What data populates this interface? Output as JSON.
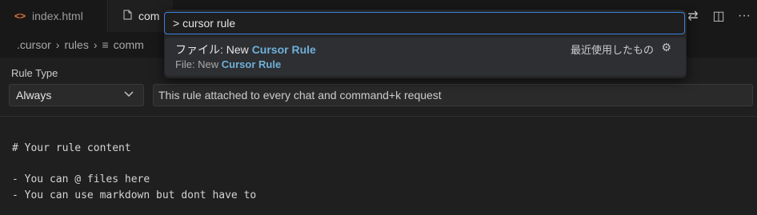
{
  "tabs": [
    {
      "label": "index.html",
      "icon": "html-code-icon"
    },
    {
      "label": "com",
      "icon": "file-icon"
    }
  ],
  "toolbar_icons": [
    "source-control-icon",
    "split-editor-icon",
    "more-icon"
  ],
  "breadcrumb": {
    "part1": ".cursor",
    "part2": "rules",
    "part3": "comm"
  },
  "rule_type": {
    "label": "Rule Type",
    "value": "Always"
  },
  "description": "This rule attached to every chat and command+k request",
  "code_lines": [
    "# Your rule content",
    "",
    "- You can @ files here",
    "- You can use markdown but dont have to"
  ],
  "palette": {
    "input_value": "> cursor rule",
    "item": {
      "line1_prefix": "ファイル: New ",
      "line1_match": "Cursor Rule",
      "line2_prefix": "File: New ",
      "line2_match": "Cursor Rule",
      "recent_label": "最近使用したもの"
    }
  },
  "colors": {
    "accent": "#3c7fdc",
    "highlight": "#6fb0d8",
    "html_icon": "#e37933"
  }
}
